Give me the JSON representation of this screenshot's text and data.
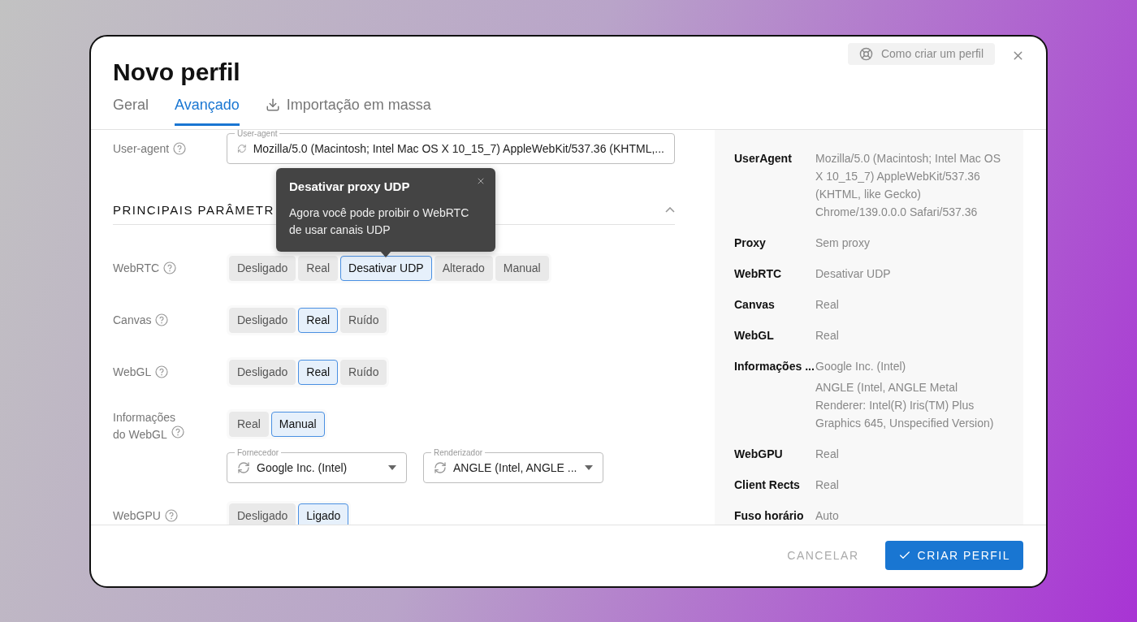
{
  "dialog": {
    "title": "Novo perfil",
    "help_button": "Como criar um perfil"
  },
  "tabs": [
    {
      "label": "Geral",
      "selected": false,
      "icon": false
    },
    {
      "label": "Avançado",
      "selected": true,
      "icon": false
    },
    {
      "label": "Importação em massa",
      "selected": false,
      "icon": true
    }
  ],
  "user_agent": {
    "label": "User-agent",
    "field_label": "User-agent",
    "value": "Mozilla/5.0 (Macintosh; Intel Mac OS X 10_15_7) AppleWebKit/537.36 (KHTML,..."
  },
  "section": {
    "title": "PRINCIPAIS PARÂMETR",
    "expanded": true
  },
  "settings": [
    {
      "label": "WebRTC",
      "options": [
        {
          "label": "Desligado",
          "selected": false
        },
        {
          "label": "Real",
          "selected": false
        },
        {
          "label": "Desativar UDP",
          "selected": true
        },
        {
          "label": "Alterado",
          "selected": false
        },
        {
          "label": "Manual",
          "selected": false
        }
      ]
    },
    {
      "label": "Canvas",
      "options": [
        {
          "label": "Desligado",
          "selected": false
        },
        {
          "label": "Real",
          "selected": true
        },
        {
          "label": "Ruído",
          "selected": false
        }
      ]
    },
    {
      "label": "WebGL",
      "options": [
        {
          "label": "Desligado",
          "selected": false
        },
        {
          "label": "Real",
          "selected": true
        },
        {
          "label": "Ruído",
          "selected": false
        }
      ]
    },
    {
      "label": "Informações do WebGL",
      "options": [
        {
          "label": "Real",
          "selected": false
        },
        {
          "label": "Manual",
          "selected": true
        }
      ],
      "selects": [
        {
          "label": "Fornecedor",
          "value": "Google Inc. (Intel)"
        },
        {
          "label": "Renderizador",
          "value": "ANGLE (Intel, ANGLE ..."
        }
      ]
    },
    {
      "label": "WebGPU",
      "options": [
        {
          "label": "Desligado",
          "selected": false
        },
        {
          "label": "Ligado",
          "selected": true
        }
      ]
    }
  ],
  "tooltip": {
    "title": "Desativar proxy UDP",
    "text": "Agora você pode proibir o WebRTC de usar canais UDP"
  },
  "summary": [
    {
      "label": "UserAgent",
      "values": [
        "Mozilla/5.0 (Macintosh; Intel Mac OS X 10_15_7) AppleWebKit/537.36 (KHTML, like Gecko) Chrome/139.0.0.0 Safari/537.36"
      ]
    },
    {
      "label": "Proxy",
      "values": [
        "Sem proxy"
      ]
    },
    {
      "label": "WebRTC",
      "values": [
        "Desativar UDP"
      ]
    },
    {
      "label": "Canvas",
      "values": [
        "Real"
      ]
    },
    {
      "label": "WebGL",
      "values": [
        "Real"
      ]
    },
    {
      "label": "Informações ...",
      "values": [
        "Google Inc. (Intel)",
        "ANGLE (Intel, ANGLE Metal Renderer: Intel(R) Iris(TM) Plus Graphics 645, Unspecified Version)"
      ]
    },
    {
      "label": "WebGPU",
      "values": [
        "Real"
      ]
    },
    {
      "label": "Client Rects",
      "values": [
        "Real"
      ]
    },
    {
      "label": "Fuso horário",
      "values": [
        "Auto"
      ]
    }
  ],
  "footer": {
    "cancel": "CANCELAR",
    "submit": "CRIAR PERFIL"
  }
}
